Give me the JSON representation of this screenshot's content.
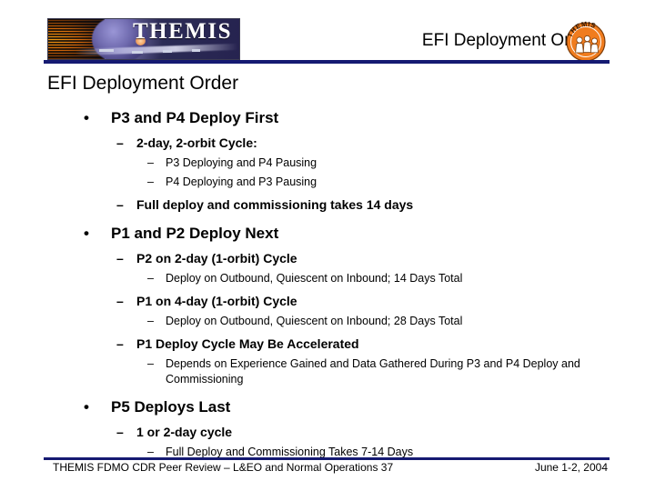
{
  "header": {
    "title": "EFI Deployment Order",
    "banner_wordmark": "THEMIS",
    "patch_label": "THEMIS",
    "rule_color": "#151a72"
  },
  "slide": {
    "heading": "EFI Deployment Order",
    "bullets": [
      {
        "level": 1,
        "marker": "•",
        "text": "P3 and P4 Deploy First"
      },
      {
        "level": 2,
        "marker": "–",
        "text": "2-day, 2-orbit Cycle:"
      },
      {
        "level": 3,
        "marker": "–",
        "text": "P3 Deploying and P4 Pausing"
      },
      {
        "level": 3,
        "marker": "–",
        "text": "P4 Deploying and P3 Pausing"
      },
      {
        "level": 2,
        "marker": "–",
        "text": "Full deploy and commissioning takes 14 days"
      },
      {
        "level": 1,
        "marker": "•",
        "text": "P1 and P2 Deploy Next"
      },
      {
        "level": 2,
        "marker": "–",
        "text": "P2 on 2-day (1-orbit) Cycle"
      },
      {
        "level": 3,
        "marker": "–",
        "text": "Deploy on Outbound, Quiescent on Inbound; 14 Days Total"
      },
      {
        "level": 2,
        "marker": "–",
        "text": "P1 on 4-day (1-orbit) Cycle"
      },
      {
        "level": 3,
        "marker": "–",
        "text": "Deploy on Outbound, Quiescent on Inbound; 28 Days Total"
      },
      {
        "level": 2,
        "marker": "–",
        "text": "P1 Deploy Cycle May Be Accelerated"
      },
      {
        "level": 3,
        "marker": "–",
        "text": "Depends on Experience Gained and Data Gathered During P3 and P4 Deploy and Commissioning"
      },
      {
        "level": 1,
        "marker": "•",
        "text": "P5 Deploys Last"
      },
      {
        "level": 2,
        "marker": "–",
        "text": "1 or 2-day cycle"
      },
      {
        "level": 3,
        "marker": "–",
        "text": "Full Deploy and Commissioning Takes 7-14 Days"
      }
    ]
  },
  "footer": {
    "left": "THEMIS FDMO CDR Peer Review – L&EO and Normal Operations 37",
    "right": "June 1-2, 2004"
  }
}
